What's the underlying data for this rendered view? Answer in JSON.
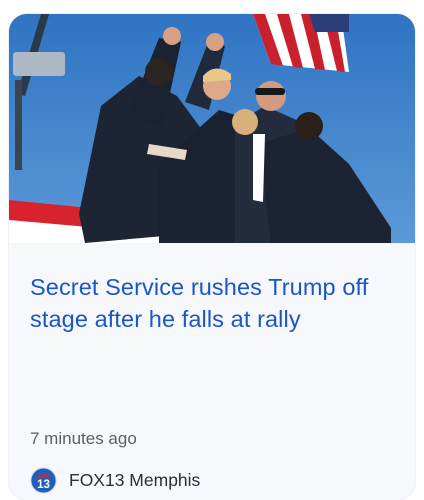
{
  "article": {
    "headline": "Secret Service rushes Trump off stage after he falls at rally",
    "timestamp": "7 minutes ago",
    "source": {
      "name": "FOX13 Memphis",
      "logo_text": "13",
      "logo_color": "#1f5fb8"
    }
  },
  "colors": {
    "headline": "#1a56c4",
    "card_background": "#f6f8fc",
    "sky": "#3d80c9",
    "stage_red": "#d8232f"
  },
  "icons": {
    "source_logo": "fox13-logo-icon"
  }
}
